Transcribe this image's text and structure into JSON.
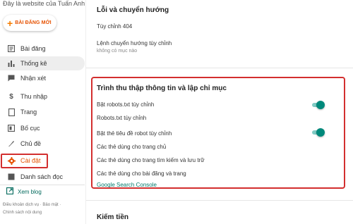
{
  "sidebar": {
    "blog_name": "Đây là website của Tuấn Anh",
    "new_post_label": "BÀI ĐĂNG MỚI",
    "items": [
      {
        "label": "Bài đăng",
        "icon": "posts-icon"
      },
      {
        "label": "Thống kê",
        "icon": "stats-icon"
      },
      {
        "label": "Nhận xét",
        "icon": "comments-icon"
      },
      {
        "label": "Thu nhập",
        "icon": "earnings-icon"
      },
      {
        "label": "Trang",
        "icon": "pages-icon"
      },
      {
        "label": "Bố cục",
        "icon": "layout-icon"
      },
      {
        "label": "Chủ đề",
        "icon": "theme-icon"
      },
      {
        "label": "Cài đặt",
        "icon": "settings-icon"
      },
      {
        "label": "Danh sách đọc",
        "icon": "reading-list-icon"
      }
    ],
    "view_blog_label": "Xem blog",
    "footer_line1": "Điều khoản dịch vụ · Bảo mật ·",
    "footer_line2": "Chính sách nội dung",
    "accent_color": "#e65100"
  },
  "errors_section": {
    "title": "Lỗi và chuyển hướng",
    "custom_404": "Tùy chỉnh 404",
    "custom_redirect": "Lệnh chuyển hướng tùy chỉnh",
    "custom_redirect_value": "không có mục nào"
  },
  "crawl_section": {
    "title": "Trình thu thập thông tin và lập chỉ mục",
    "enable_robots_txt": "Bật robots.txt tùy chỉnh",
    "robots_txt": "Robots.txt tùy chỉnh",
    "enable_robot_headers": "Bật thẻ tiêu đề robot tùy chỉnh",
    "home_tags": "Các thẻ dùng cho trang chủ",
    "archive_tags": "Các thẻ dùng cho trang tìm kiếm và lưu trữ",
    "post_tags": "Các thẻ dùng cho bài đăng và trang",
    "search_console_link": "Google Search Console",
    "toggles": {
      "robots_txt_enabled": true,
      "robot_headers_enabled": true
    },
    "toggle_color": "#00897b"
  },
  "monetization_section": {
    "title": "Kiếm tiền"
  }
}
